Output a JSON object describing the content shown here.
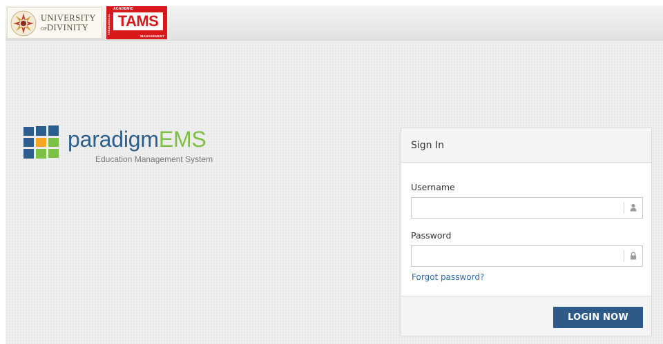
{
  "header": {
    "university_logo": {
      "line1": "UNIVERSITY",
      "of": "OF",
      "line2": "DIVINITY"
    },
    "tams_logo": {
      "top": "ACADEMIC",
      "side": "THEOLOGICAL",
      "main": "TAMS",
      "bottom": "MANAGEMENT",
      "color": "#d7191c"
    }
  },
  "brand": {
    "name_main": "paradigm",
    "name_accent": "EMS",
    "tagline": "Education Management System",
    "colors": {
      "blue": "#2d5f8e",
      "green": "#7cc143",
      "orange": "#f5a623"
    }
  },
  "signin": {
    "title": "Sign In",
    "username": {
      "label": "Username",
      "value": "",
      "placeholder": "",
      "icon": "user-icon"
    },
    "password": {
      "label": "Password",
      "value": "",
      "placeholder": "",
      "icon": "lock-icon"
    },
    "forgot_label": "Forgot password?",
    "login_label": "LOGIN NOW",
    "button_color": "#2e5a88"
  }
}
